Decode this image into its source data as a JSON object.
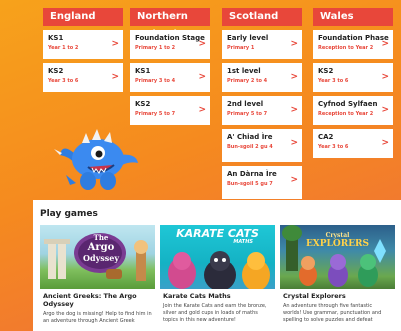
{
  "columns": [
    {
      "heading": "England",
      "items": [
        {
          "title": "KS1",
          "sub": "Year 1 to 2"
        },
        {
          "title": "KS2",
          "sub": "Year 3 to 6"
        }
      ]
    },
    {
      "heading": "Northern Ireland",
      "items": [
        {
          "title": "Foundation Stage",
          "sub": "Primary 1 to 2"
        },
        {
          "title": "KS1",
          "sub": "Primary 3 to 4"
        },
        {
          "title": "KS2",
          "sub": "Primary 5 to 7"
        }
      ]
    },
    {
      "heading": "Scotland",
      "items": [
        {
          "title": "Early level",
          "sub": "Primary 1"
        },
        {
          "title": "1st level",
          "sub": "Primary 2 to 4"
        },
        {
          "title": "2nd level",
          "sub": "Primary 5 to 7"
        },
        {
          "title": "A' Chiad Ìre",
          "sub": "Bun-sgoil 2 gu 4"
        },
        {
          "title": "An Dàrna Ìre",
          "sub": "Bun-sgoil 5 gu 7"
        }
      ]
    },
    {
      "heading": "Wales",
      "items": [
        {
          "title": "Foundation Phase",
          "sub": "Reception to Year 2"
        },
        {
          "title": "KS2",
          "sub": "Year 3 to 6"
        },
        {
          "title": "Cyfnod Sylfaen",
          "sub": "Reception to Year 2"
        },
        {
          "title": "CA2",
          "sub": "Year 3 to 6"
        }
      ]
    }
  ],
  "chevron": ">",
  "games": {
    "heading": "Play games",
    "list": [
      {
        "logo_line1": "The",
        "logo_line2": "Argo",
        "logo_line3": "Odyssey",
        "title": "Ancient Greeks: The Argo Odyssey",
        "desc": "Argo the dog is missing! Help to find him in an adventure through Ancient Greek"
      },
      {
        "logo_line1": "KARATE CATS",
        "logo_line2": "MATHS",
        "logo_line3": "",
        "title": "Karate Cats Maths",
        "desc": "Join the Karate Cats and earn the bronze, silver and gold cups in loads of maths topics in this new adventure!"
      },
      {
        "logo_line1": "Crystal",
        "logo_line2": "EXPLORERS",
        "logo_line3": "",
        "title": "Crystal Explorers",
        "desc": "An adventure through five fantastic worlds! Use grammar, punctuation and spelling to solve puzzles and defeat"
      }
    ]
  }
}
